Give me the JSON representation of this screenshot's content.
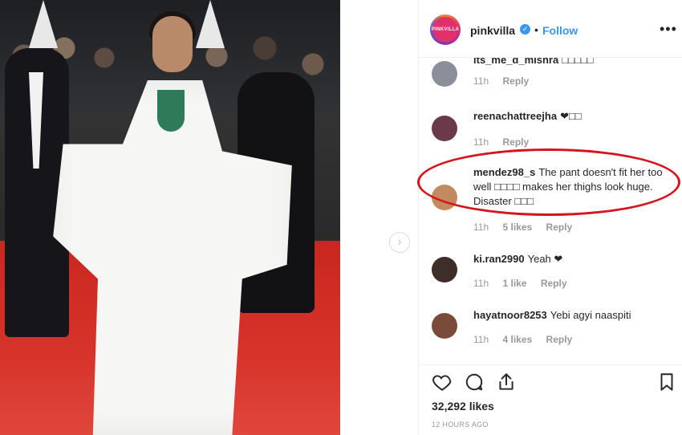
{
  "post": {
    "account": {
      "username": "pinkvilla",
      "avatar_text": "PINKVILLA",
      "verified_icon": "✓",
      "separator": "•",
      "follow_label": "Follow",
      "more_label": "•••"
    },
    "next_arrow": "›",
    "comments": [
      {
        "user": "its_me_d_mishra",
        "text": "□□□□□",
        "time": "11h",
        "likes": "",
        "reply": "Reply",
        "avatar_color": "#8a8f99"
      },
      {
        "user": "reenachattreejha",
        "text": "❤□□",
        "time": "11h",
        "likes": "",
        "reply": "Reply",
        "avatar_color": "#6b3a4a"
      },
      {
        "user": "mendez98_s",
        "text": "The pant doesn't fit her too well □□□□ makes her thighs look huge. Disaster □□□",
        "time": "11h",
        "likes": "5 likes",
        "reply": "Reply",
        "avatar_color": "#c28a5f"
      },
      {
        "user": "ki.ran2990",
        "text": "Yeah ❤",
        "time": "11h",
        "likes": "1 like",
        "reply": "Reply",
        "avatar_color": "#3d2e2a"
      },
      {
        "user": "hayatnoor8253",
        "text": "Yebi agyi naaspiti",
        "time": "11h",
        "likes": "4 likes",
        "reply": "Reply",
        "avatar_color": "#7a4a3a"
      }
    ],
    "likes_text": "32,292 likes",
    "timestamp": "12 HOURS AGO"
  },
  "colors": {
    "accent": "#3897f0",
    "highlight": "#d4151d",
    "muted": "#999999"
  },
  "icons": [
    "heart-icon",
    "comment-icon",
    "share-icon",
    "bookmark-icon"
  ]
}
